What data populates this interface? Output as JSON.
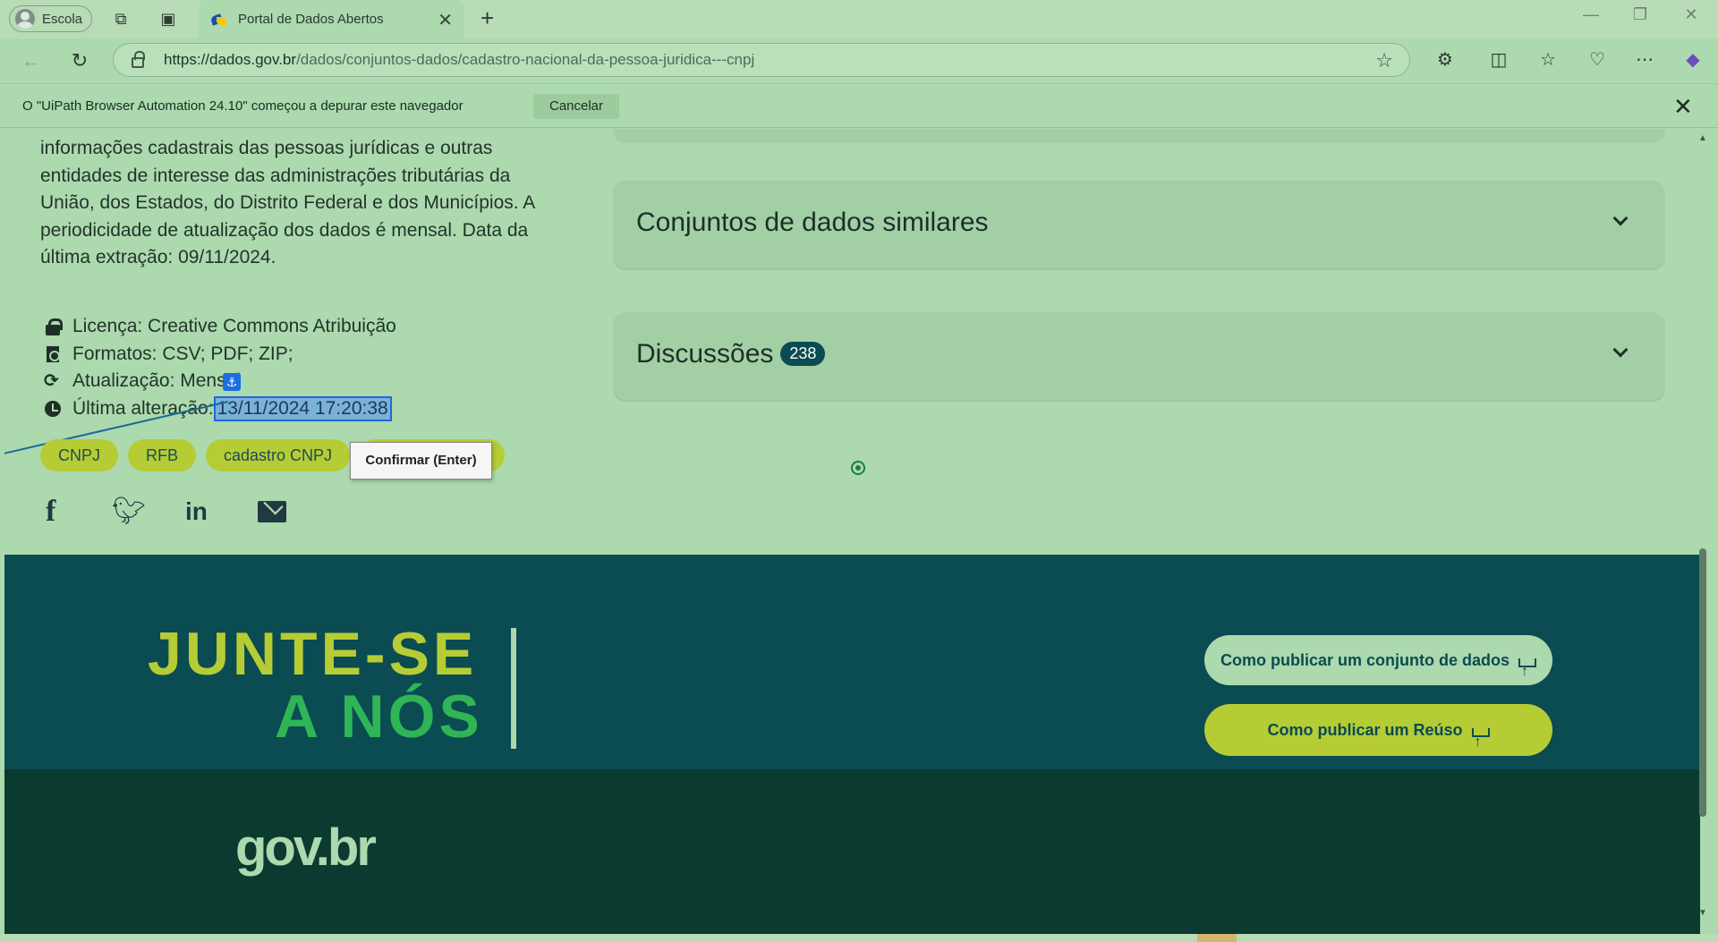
{
  "browser": {
    "profile_label": "Escola",
    "tab_title": "Portal de Dados Abertos",
    "url_host": "https://dados.gov.br",
    "url_path": "/dados/conjuntos-dados/cadastro-nacional-da-pessoa-juridica---cnpj"
  },
  "infobar": {
    "message": "O \"UiPath Browser Automation 24.10\" começou a depurar este navegador",
    "cancel_label": "Cancelar"
  },
  "dataset": {
    "description": "informações cadastrais das pessoas jurídicas e outras entidades de interesse das administrações tributárias da União, dos Estados, do Distrito Federal e dos Municípios. A periodicidade de atualização dos dados é mensal. Data da última extração: 09/11/2024.",
    "license": "Licença: Creative Commons Atribuição",
    "formats": "Formatos: CSV; PDF; ZIP;",
    "update": "Atualização: Mensal",
    "last_change_label": "Última alteração:",
    "last_change_value": "13/11/2024 17:20:38",
    "tags": [
      "CNPJ",
      "RFB",
      "cadastro CNPJ"
    ]
  },
  "automation": {
    "anchor_glyph": "⚓",
    "tooltip": "Confirmar (Enter)"
  },
  "panels": {
    "similar_title": "Conjuntos de dados similares",
    "discussions_title": "Discussões",
    "discussions_count": "238"
  },
  "join": {
    "line1": "JUNTE-SE",
    "line2": "A NÓS",
    "publish_dataset": "Como publicar um conjunto de dados",
    "publish_reuse": "Como publicar um Reúso"
  },
  "footer": {
    "logo": "gov.br"
  },
  "colors": {
    "page_bg": "#acd9ad",
    "join_bg": "#0b4b52",
    "footer_bg": "#0b3a30",
    "tag_bg": "#b6cc35",
    "selection_border": "#2266dd"
  }
}
